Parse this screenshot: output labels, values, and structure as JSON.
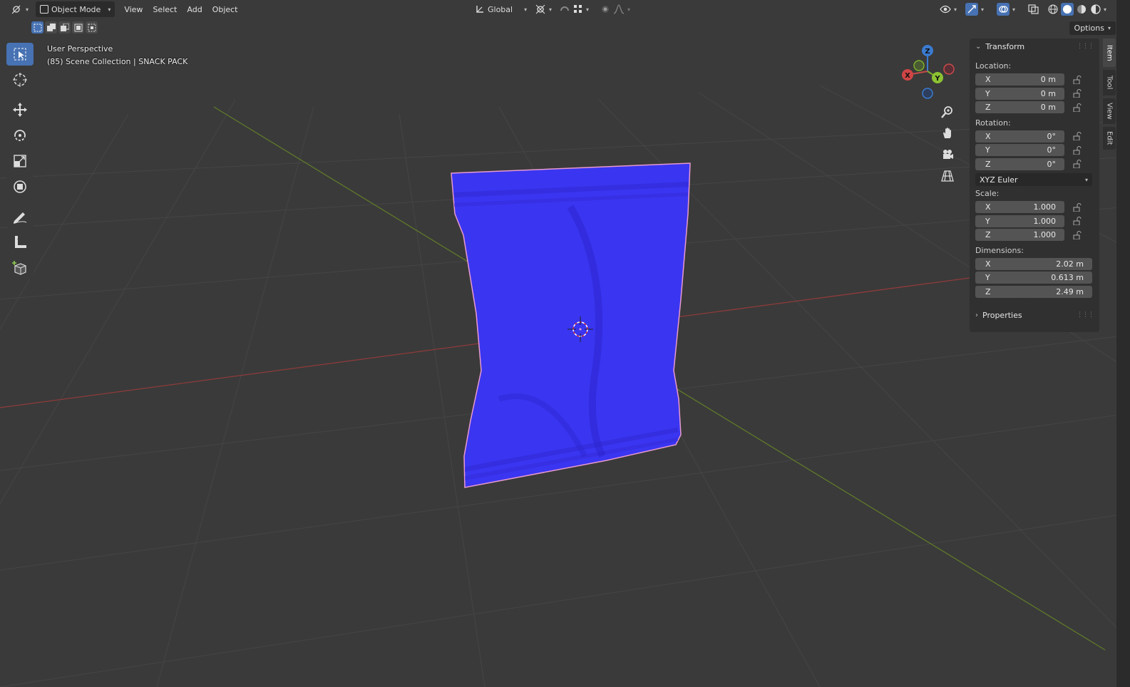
{
  "header": {
    "editor_icon": "editor-type-3d-viewport-icon",
    "mode_label": "Object Mode",
    "menus": [
      "View",
      "Select",
      "Add",
      "Object"
    ],
    "transform_orientation": "Global"
  },
  "options_label": "Options",
  "overlay": {
    "view_name": "User Perspective",
    "collection_info": "(85) Scene Collection | SNACK PACK"
  },
  "gizmo": {
    "x": "X",
    "y": "Y",
    "z": "Z"
  },
  "colors": {
    "accent": "#4772b3",
    "object": "#3a35f0",
    "outline": "#e89ad0",
    "axis_x": "#c84a4a",
    "axis_y": "#7ab02c",
    "axis_z": "#3b7bd0"
  },
  "panel": {
    "transform_title": "Transform",
    "location_label": "Location:",
    "location": [
      {
        "axis": "X",
        "value": "0 m"
      },
      {
        "axis": "Y",
        "value": "0 m"
      },
      {
        "axis": "Z",
        "value": "0 m"
      }
    ],
    "rotation_label": "Rotation:",
    "rotation": [
      {
        "axis": "X",
        "value": "0°"
      },
      {
        "axis": "Y",
        "value": "0°"
      },
      {
        "axis": "Z",
        "value": "0°"
      }
    ],
    "rotation_mode": "XYZ Euler",
    "scale_label": "Scale:",
    "scale": [
      {
        "axis": "X",
        "value": "1.000"
      },
      {
        "axis": "Y",
        "value": "1.000"
      },
      {
        "axis": "Z",
        "value": "1.000"
      }
    ],
    "dimensions_label": "Dimensions:",
    "dimensions": [
      {
        "axis": "X",
        "value": "2.02 m"
      },
      {
        "axis": "Y",
        "value": "0.613 m"
      },
      {
        "axis": "Z",
        "value": "2.49 m"
      }
    ],
    "properties_title": "Properties"
  },
  "tabs": [
    "Item",
    "Tool",
    "View",
    "Edit"
  ]
}
